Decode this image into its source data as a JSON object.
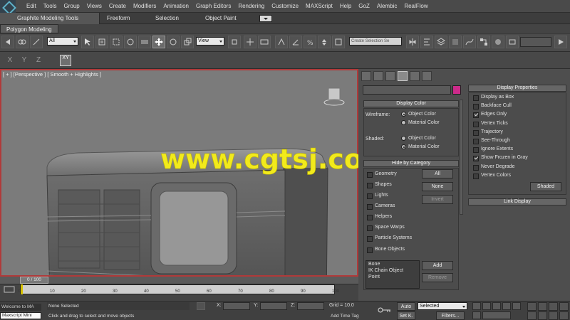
{
  "menu": {
    "items": [
      "Edit",
      "Tools",
      "Group",
      "Views",
      "Create",
      "Modifiers",
      "Animation",
      "Graph Editors",
      "Rendering",
      "Customize",
      "MAXScript",
      "Help",
      "GoZ",
      "Alembic",
      "RealFlow"
    ]
  },
  "ribbon": {
    "tabs": [
      "Graphite Modeling Tools",
      "Freeform",
      "Selection",
      "Object Paint"
    ],
    "panel": "Polygon Modeling"
  },
  "toolbar": {
    "filter": "All",
    "ref_coord": "View",
    "selection_set_placeholder": "Create Selection Se"
  },
  "axis_constraints": [
    "X",
    "Y",
    "Z",
    "XY"
  ],
  "viewport": {
    "label": "[ + ] [Perspective ] [ Smooth + Highlights ]",
    "watermark": "www.cgtsj.com"
  },
  "display_color": {
    "title": "Display Color",
    "wireframe_label": "Wireframe:",
    "shaded_label": "Shaded:",
    "object_color": "Object Color",
    "material_color": "Material Color",
    "wireframe_selected": "object_color",
    "shaded_selected": "material_color"
  },
  "hide_by_category": {
    "title": "Hide by Category",
    "items": [
      "Geometry",
      "Shapes",
      "Lights",
      "Cameras",
      "Helpers",
      "Space Warps",
      "Particle Systems",
      "Bone Objects"
    ],
    "buttons": [
      "All",
      "None",
      "Invert"
    ],
    "list_items": [
      "Bone",
      "IK Chain Object",
      "Point"
    ],
    "add_label": "Add",
    "remove_label": "Remove"
  },
  "display_properties": {
    "title": "Display Properties",
    "items": [
      {
        "label": "Display as Box",
        "checked": false
      },
      {
        "label": "Backface Cull",
        "checked": false
      },
      {
        "label": "Edges Only",
        "checked": true
      },
      {
        "label": "Vertex Ticks",
        "checked": false
      },
      {
        "label": "Trajectory",
        "checked": false
      },
      {
        "label": "See-Through",
        "checked": false
      },
      {
        "label": "Ignore Extents",
        "checked": false
      },
      {
        "label": "Show Frozen in Gray",
        "checked": true
      },
      {
        "label": "Never Degrade",
        "checked": false
      },
      {
        "label": "Vertex Colors",
        "checked": false
      }
    ],
    "shaded_button": "Shaded",
    "link_display": "Link Display"
  },
  "timeline": {
    "position": "0 / 100",
    "ticks": [
      "0",
      "10",
      "20",
      "30",
      "40",
      "50",
      "60",
      "70",
      "80",
      "90",
      "100"
    ]
  },
  "status": {
    "maxscript": "Welcome to MA",
    "maxscript_mini": "Maxscript Mini",
    "selection": "None Selected",
    "prompt": "Click and drag to select and move objects",
    "x_label": "X:",
    "y_label": "Y:",
    "z_label": "Z:",
    "grid": "Grid = 10.0",
    "add_time_tag": "Add Time Tag",
    "auto_key": "Auto",
    "set_key": "Set K.",
    "key_mode": "Selected",
    "key_filters": "Filters..."
  },
  "colors": {
    "viewport_border": "#b03a3a",
    "object_swatch": "#cc2a8a",
    "watermark": "#f2ea1c"
  }
}
